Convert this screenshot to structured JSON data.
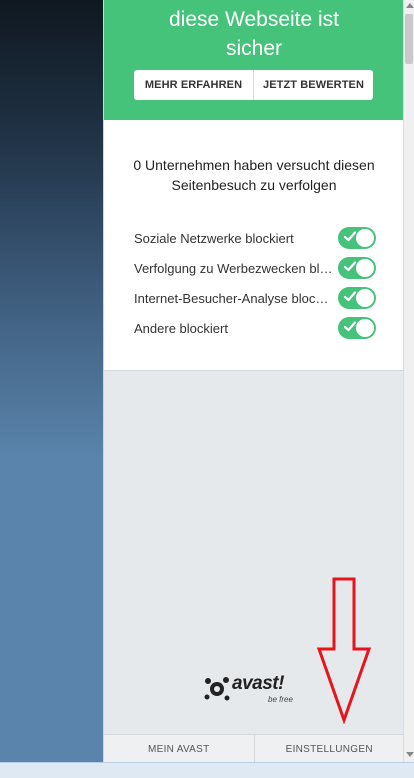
{
  "header": {
    "title": "diese Webseite ist\nsicher",
    "buttons": {
      "learn_more": "MEHR ERFAHREN",
      "rate_now": "JETZT BEWERTEN"
    }
  },
  "tracking": {
    "summary": "0 Unternehmen haben versucht diesen\nSeitenbesuch zu verfolgen",
    "items": [
      {
        "label": "Soziale Netzwerke blockiert",
        "enabled": true
      },
      {
        "label": "Verfolgung zu Werbezwecken blockiert",
        "enabled": true
      },
      {
        "label": "Internet-Besucher-Analyse blockiert",
        "enabled": true
      },
      {
        "label": "Andere blockiert",
        "enabled": true
      }
    ]
  },
  "logo": {
    "word": "avast!",
    "tagline": "be free"
  },
  "footer": {
    "my_avast": "MEIN AVAST",
    "settings": "EINSTELLUNGEN"
  },
  "colors": {
    "accent_green": "#46c37b",
    "annotation_red": "#e8141b",
    "page_blue": "#5a84ab"
  }
}
